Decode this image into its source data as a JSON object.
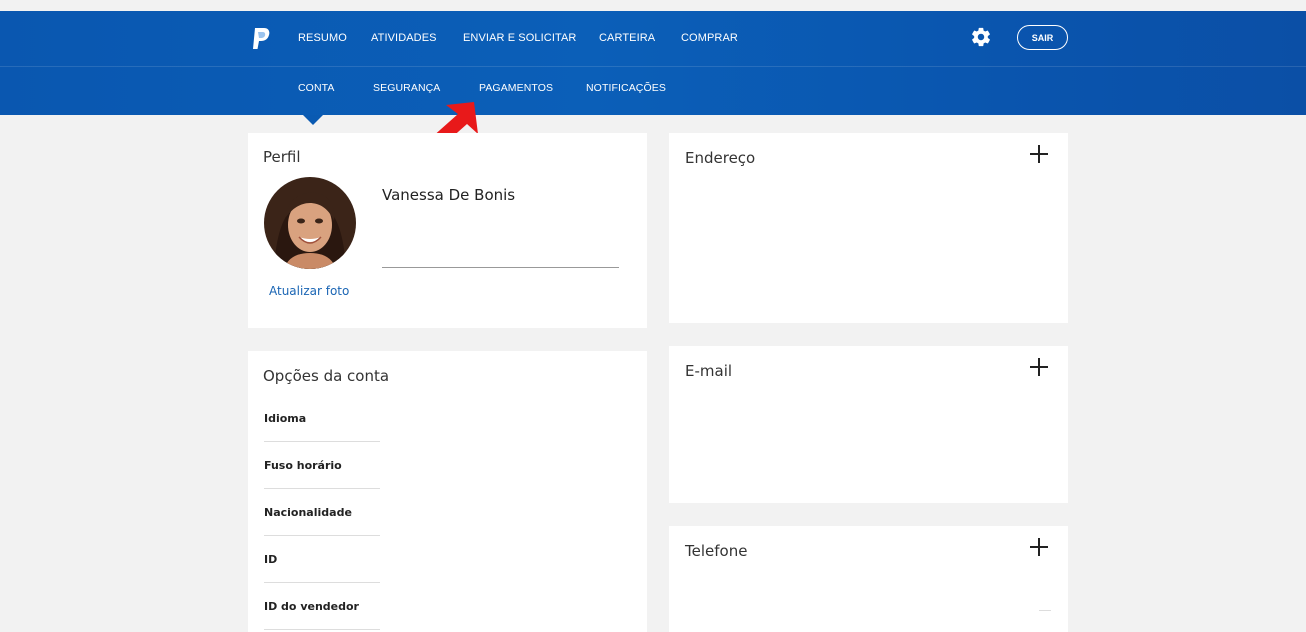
{
  "nav": {
    "primary": [
      "RESUMO",
      "ATIVIDADES",
      "ENVIAR E SOLICITAR",
      "CARTEIRA",
      "COMPRAR"
    ],
    "secondary": [
      "CONTA",
      "SEGURANÇA",
      "PAGAMENTOS",
      "NOTIFICAÇÕES"
    ],
    "active_secondary": "CONTA",
    "logout_label": "SAIR",
    "settings_icon": "gear-icon",
    "logo_icon": "paypal-logo-icon"
  },
  "annotation": {
    "arrow_icon": "red-arrow-icon",
    "arrow_color": "#e8191a"
  },
  "profile": {
    "title": "Perfil",
    "name": "Vanessa De Bonis",
    "update_photo_label": "Atualizar foto"
  },
  "account_options": {
    "title": "Opções da conta",
    "items": [
      "Idioma",
      "Fuso horário",
      "Nacionalidade",
      "ID",
      "ID do vendedor"
    ]
  },
  "address": {
    "title": "Endereço"
  },
  "email": {
    "title": "E-mail"
  },
  "phone": {
    "title": "Telefone"
  },
  "colors": {
    "header": "#0a5ab2",
    "link": "#1a65b4",
    "background": "#f2f2f2"
  }
}
